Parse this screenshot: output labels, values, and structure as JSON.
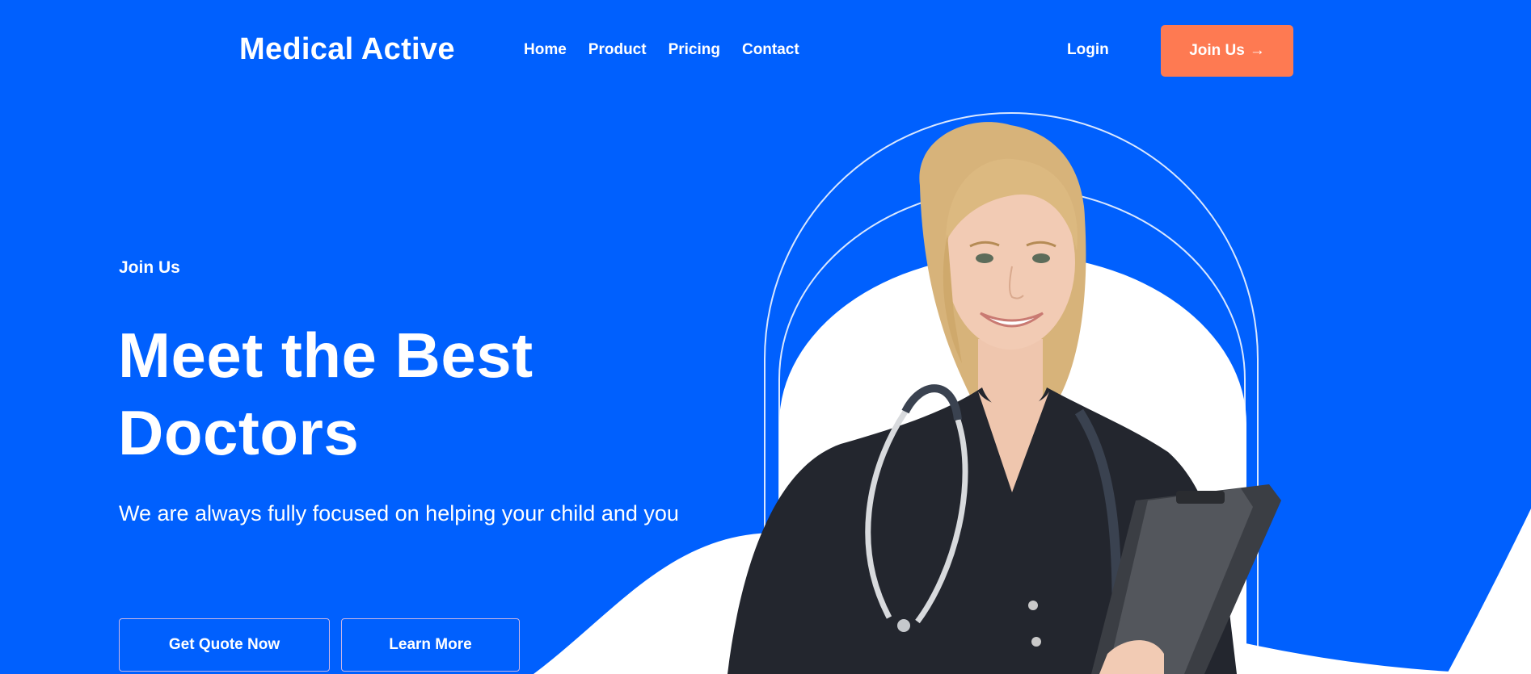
{
  "header": {
    "brand": "Medical Active",
    "nav": [
      "Home",
      "Product",
      "Pricing",
      "Contact"
    ],
    "login_label": "Login",
    "join_label": "Join Us",
    "join_arrow": "→"
  },
  "hero": {
    "eyebrow": "Join Us",
    "headline_line1": "Meet the Best",
    "headline_line2": "Doctors",
    "subtext": "We are always fully focused on helping your child and you",
    "primary_cta": "Get Quote Now",
    "secondary_cta": "Learn More"
  },
  "colors": {
    "background": "#0060fe",
    "accent": "#fe7a52",
    "text": "#ffffff"
  },
  "icons": {
    "join_arrow": "arrow-right-icon"
  }
}
